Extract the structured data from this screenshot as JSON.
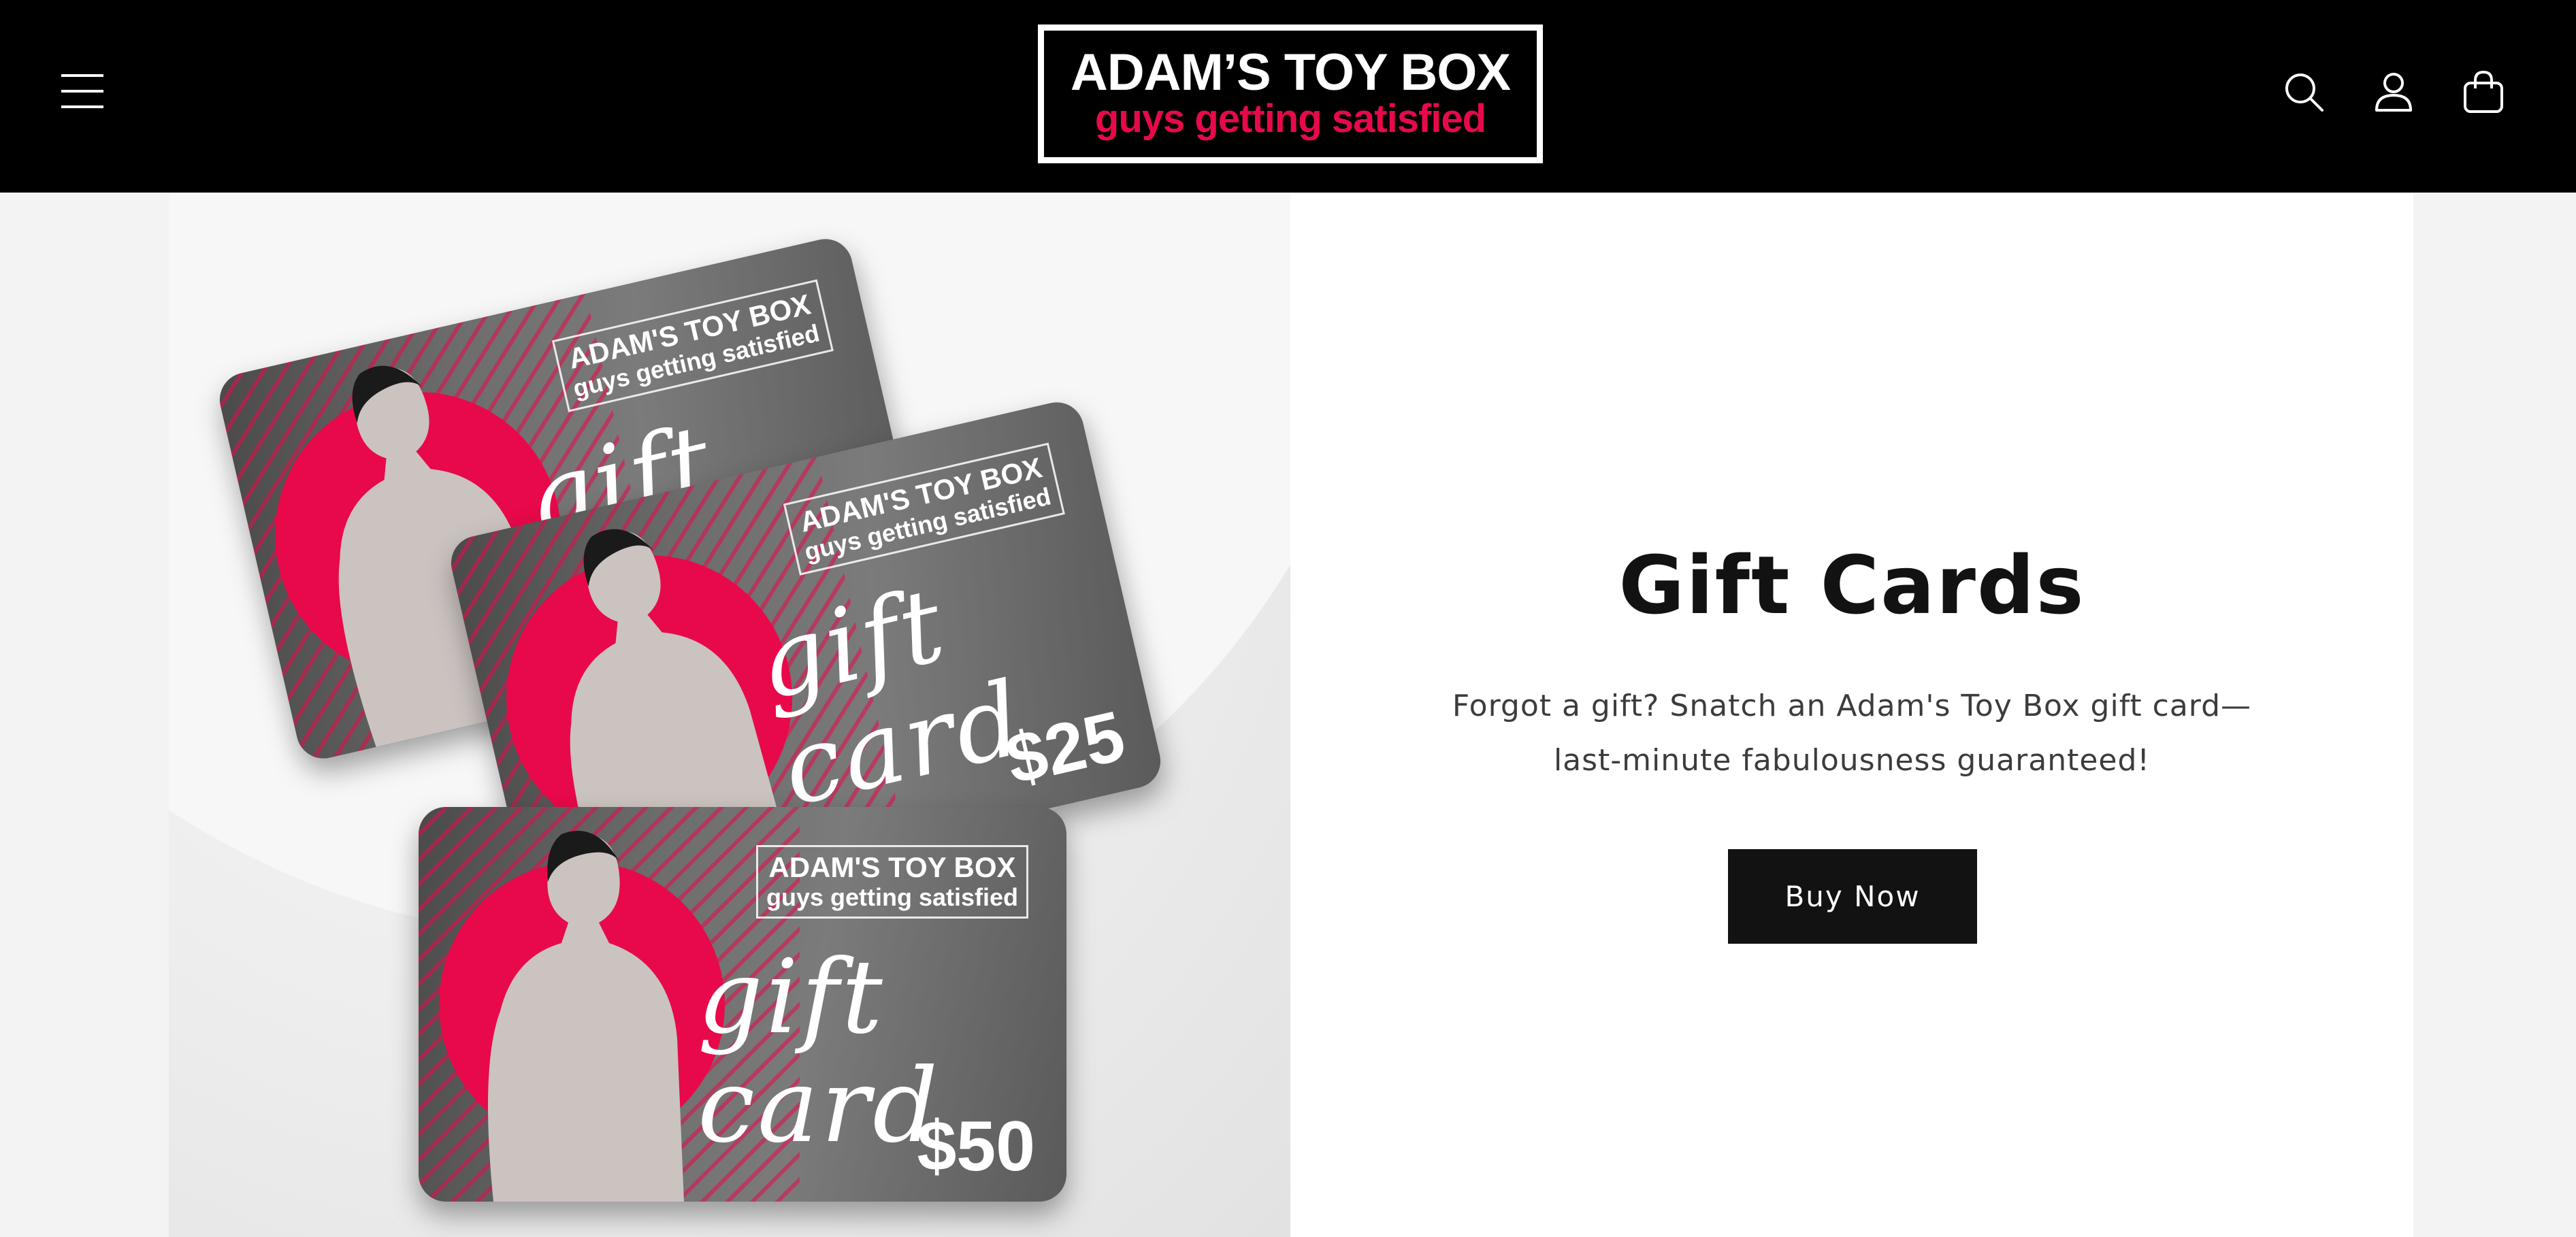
{
  "header": {
    "menu_icon": "hamburger-menu-icon",
    "logo": {
      "line1": "ADAM’S TOY BOX",
      "line2": "guys getting satisfied",
      "brand_color": "#e8094a"
    },
    "icons": [
      "search-icon",
      "account-icon",
      "cart-icon"
    ]
  },
  "hero": {
    "image": {
      "cards": [
        {
          "brand": "ADAM'S TOY BOX",
          "tagline": "guys getting satisfied",
          "script": "gift card",
          "amount": ""
        },
        {
          "brand": "ADAM'S TOY BOX",
          "tagline": "guys getting satisfied",
          "script": "gift card",
          "amount": "$25"
        },
        {
          "brand": "ADAM'S TOY BOX",
          "tagline": "guys getting satisfied",
          "script": "gift card",
          "amount": "$50"
        }
      ]
    },
    "title": "Gift Cards",
    "description": "Forgot a gift? Snatch an Adam's Toy Box gift card—last-minute fabulousness guaranteed!",
    "button_label": "Buy Now"
  },
  "colors": {
    "header_bg": "#000000",
    "accent": "#e8094a",
    "button_bg": "#121212"
  }
}
